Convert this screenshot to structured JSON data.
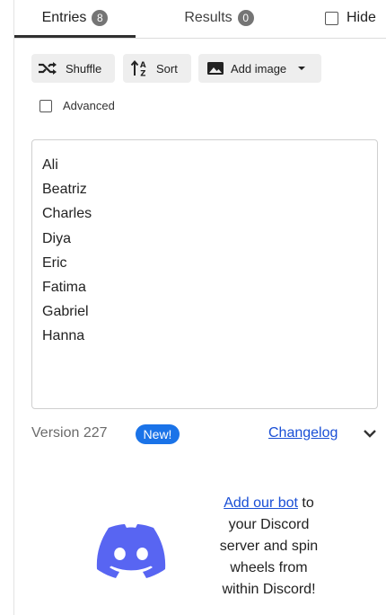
{
  "tabs": {
    "entries": {
      "label": "Entries",
      "count": "8"
    },
    "results": {
      "label": "Results",
      "count": "0"
    },
    "hide_label": "Hide"
  },
  "toolbar": {
    "shuffle_label": "Shuffle",
    "sort_label": "Sort",
    "add_image_label": "Add image"
  },
  "advanced_label": "Advanced",
  "entries": [
    "Ali",
    "Beatriz",
    "Charles",
    "Diya",
    "Eric",
    "Fatima",
    "Gabriel",
    "Hanna"
  ],
  "version": {
    "text": "Version 227",
    "badge": "New!",
    "changelog_label": "Changelog"
  },
  "discord": {
    "link_text": "Add our bot",
    "line1_rest": " to",
    "line2": "your Discord",
    "line3": "server and spin",
    "line4": "wheels from",
    "line5": "within Discord!"
  },
  "colors": {
    "accent": "#1a73e8",
    "discord_blurple": "#5865f2",
    "link": "#1a4fd6",
    "button_bg": "#eeeeee"
  },
  "icons": [
    "shuffle-icon",
    "sort-alpha-icon",
    "image-icon",
    "caret-down-icon",
    "chevron-down-icon",
    "discord-logo-icon"
  ]
}
